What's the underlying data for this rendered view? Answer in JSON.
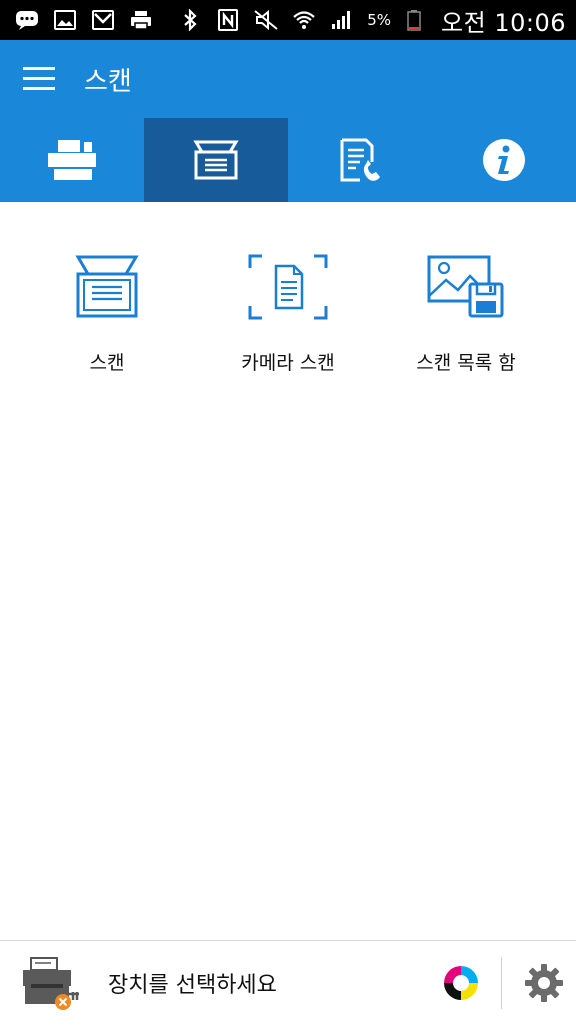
{
  "status_bar": {
    "left_icons": [
      "chat-bubble-icon",
      "image-icon",
      "mail-icon",
      "printer-icon"
    ],
    "right_icons": [
      "bluetooth-icon",
      "nfc-icon",
      "mute-icon",
      "wifi-icon",
      "signal-icon"
    ],
    "battery_percent": "5%",
    "clock": "오전 10:06"
  },
  "appbar": {
    "title": "스캔"
  },
  "tabs": [
    {
      "name": "print",
      "icon": "printer-icon",
      "active": false
    },
    {
      "name": "scan",
      "icon": "scanner-icon",
      "active": true
    },
    {
      "name": "fax",
      "icon": "fax-icon",
      "active": false
    },
    {
      "name": "info",
      "icon": "info-icon",
      "active": false
    }
  ],
  "scan_options": [
    {
      "label": "스캔",
      "icon": "scanner-icon"
    },
    {
      "label": "카메라 스캔",
      "icon": "camera-scan-icon"
    },
    {
      "label": "스캔 목록 함",
      "icon": "scan-list-icon"
    }
  ],
  "bottom_bar": {
    "device_prompt": "장치를 선택하세요"
  },
  "colors": {
    "primary": "#1a87d8",
    "active_tab": "#185b9b",
    "icon_blue": "#1a7fd4",
    "error_badge": "#f08a24"
  }
}
